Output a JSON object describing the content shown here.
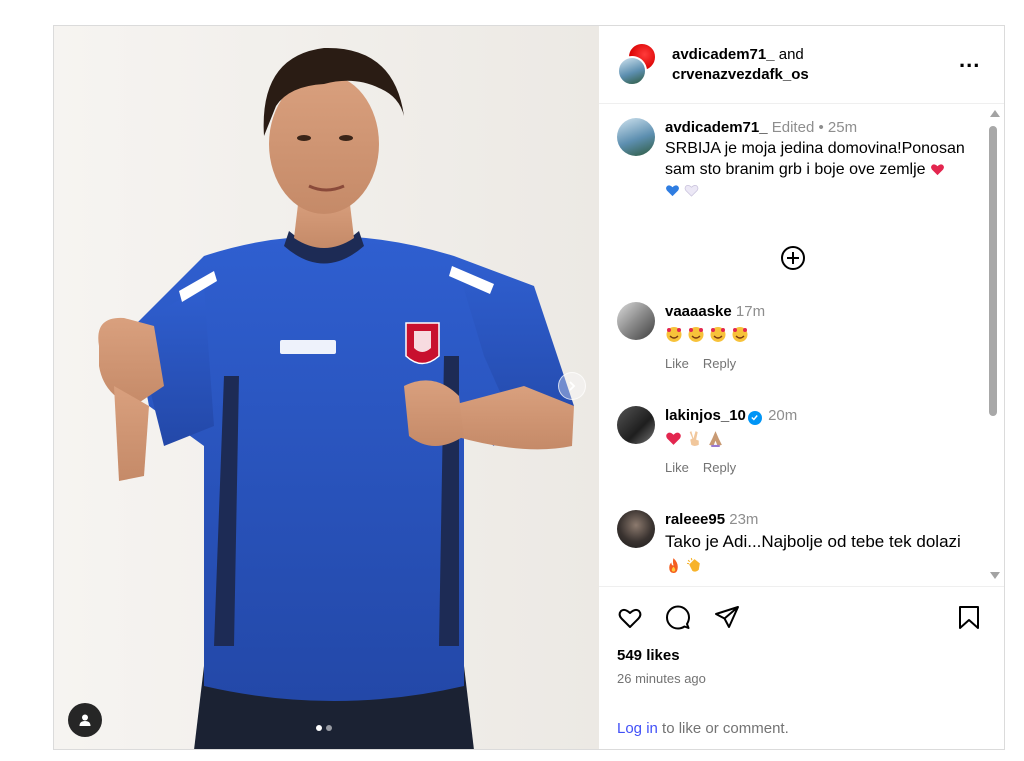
{
  "post": {
    "collaborators": [
      "avdicadem71_",
      "crvenazvezdafk_os"
    ],
    "header_joiner": "and",
    "more_label": "...",
    "caption": {
      "username": "avdicadem71_",
      "edited": "Edited",
      "separator": "•",
      "time": "25m",
      "text": "SRBIJA je moja jedina domovina!Ponosan sam sto branim grb i boje ove zemlje",
      "emojis": [
        "red-heart",
        "blue-heart",
        "white-heart"
      ]
    },
    "comments": [
      {
        "username": "vaaaaske",
        "time": "17m",
        "verified": false,
        "text": "",
        "emojis": [
          "smiling-face-with-hearts",
          "smiling-face-with-hearts",
          "smiling-face-with-hearts",
          "smiling-face-with-hearts"
        ],
        "like_label": "Like",
        "reply_label": "Reply"
      },
      {
        "username": "lakinjos_10",
        "time": "20m",
        "verified": true,
        "text": "",
        "emojis": [
          "red-heart",
          "victory-hand",
          "folded-hands"
        ],
        "like_label": "Like",
        "reply_label": "Reply"
      },
      {
        "username": "raleee95",
        "time": "23m",
        "verified": false,
        "text": "Tako je Adi...Najbolje od tebe tek dolazi",
        "emojis": [
          "fire",
          "clapping-hands"
        ]
      }
    ],
    "likes": "549 likes",
    "posted_ago": "26 minutes ago",
    "login_link": "Log in",
    "login_rest": " to like or comment.",
    "carousel": {
      "count": 2,
      "active": 1
    },
    "icons": [
      "heart-icon",
      "comment-icon",
      "share-icon",
      "bookmark-icon",
      "more-icon",
      "user-tag-icon",
      "next-arrow-icon",
      "add-circle-icon"
    ],
    "colors": {
      "link": "#4150f7",
      "muted": "#737373",
      "verified": "#0095f6",
      "jersey": "#2b55c2"
    }
  }
}
